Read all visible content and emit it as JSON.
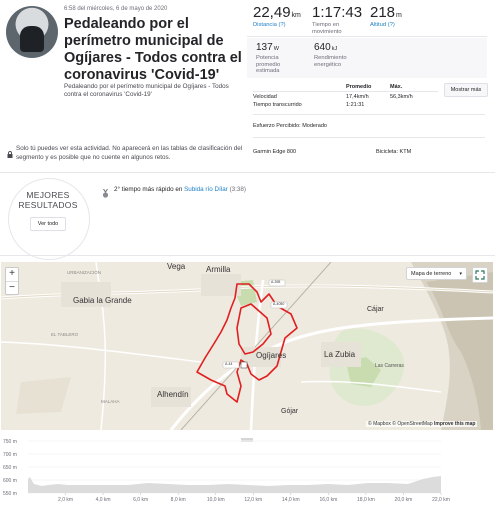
{
  "activity": {
    "meta": "6:58 del miércoles, 6 de mayo de 2020",
    "title": "Pedaleando por el perímetro municipal de Ogíjares - Todos contra el coronavirus 'Covid-19'",
    "description": "Pedaleando por el perímetro municipal de Ogíjares - Todos contra el coronavirus 'Covid-19'"
  },
  "stats": {
    "distance": {
      "value": "22,49",
      "unit": "km",
      "label": "Distancia (?)"
    },
    "moving_time": {
      "value": "1:17:43",
      "label": "Tiempo en movimiento"
    },
    "elevation": {
      "value": "218",
      "unit": "m",
      "label": "Altitud (?)"
    },
    "power": {
      "value": "137",
      "unit": "W",
      "label": "Potencia promedio estimada"
    },
    "energy": {
      "value": "640",
      "unit": "kJ",
      "label": "Rendimiento energético"
    }
  },
  "table": {
    "col_avg": "Promedio",
    "col_max": "Máx.",
    "more_button": "Mostrar más",
    "rows": [
      {
        "label": "Velocidad",
        "avg": "17,4km/h",
        "max": "56,3km/h"
      },
      {
        "label": "Tiempo transcurrido",
        "avg": "1:21:31",
        "max": ""
      }
    ],
    "effort": "Esfuerzo Percibido: Moderado",
    "device": "Garmin Edge 800",
    "bike": "Bicicleta: KTM"
  },
  "privacy_notice": "Solo tú puedes ver esta actividad. No aparecerá en las tablas de clasificación del segmento y es posible que no cuente en algunos retos.",
  "best_results": {
    "title_line1": "MEJORES",
    "title_line2": "RESULTADOS",
    "button": "Ver todo",
    "achievement_prefix": "2° tiempo más rápido en",
    "achievement_segment": "Subida río Dílar",
    "achievement_time": "(3:38)"
  },
  "map": {
    "zoom_in": "+",
    "zoom_out": "−",
    "type_select": "Mapa de terreno",
    "attribution_1": "© Mapbox © OpenStreetMap",
    "attribution_2": "Improve this map",
    "places": {
      "vega": "Vega",
      "armilla": "Armilla",
      "gabia": "Gabia la Grande",
      "cajar": "Cájar",
      "ogijares": "Ogíjares",
      "zubia": "La Zubia",
      "alhendin": "Alhendín",
      "gojar": "Gójar",
      "carreras": "Las Carreras",
      "urbanizacion": "URBANIZACIÓN",
      "tablero": "EL TABLERO",
      "malaha": "MALAHA"
    },
    "roads": {
      "a4050": "A-4050",
      "a44": "A-44",
      "a395": "A-395"
    },
    "route_color": "#e02020"
  },
  "elevation_chart": {
    "y_ticks": [
      "750 m",
      "700 m",
      "650 m",
      "600 m",
      "550 m"
    ],
    "x_ticks": [
      "2,0 km",
      "4,0 km",
      "6,0 km",
      "8,0 km",
      "10,0 km",
      "12,0 km",
      "14,0 km",
      "16,0 km",
      "18,0 km",
      "20,0 km",
      "22,0 km"
    ],
    "fill_color": "#dcdcdc"
  },
  "colors": {
    "accent": "#fc4c02",
    "link": "#1c7fc3",
    "route": "#e02020"
  }
}
